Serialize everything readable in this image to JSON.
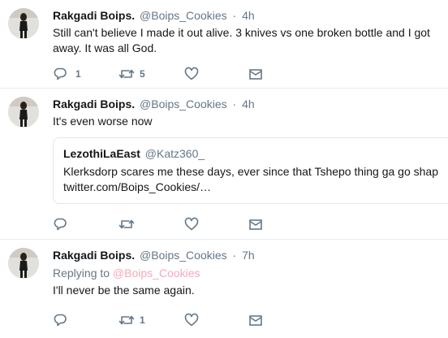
{
  "tweets": [
    {
      "fullname": "Rakgadi Boips.",
      "username": "@Boips_Cookies",
      "separator": "·",
      "time": "4h",
      "text": "Still can't believe I made it out alive. 3 knives vs one broken bottle and I got away. It was all God.",
      "reply_count": "1",
      "retweet_count": "5",
      "like_count": ""
    },
    {
      "fullname": "Rakgadi Boips.",
      "username": "@Boips_Cookies",
      "separator": "·",
      "time": "4h",
      "text": "It's even worse now",
      "quote": {
        "fullname": "LezothiLaEast",
        "username": "@Katz360_",
        "text_line1": "Klerksdorp scares me these days, ever since that Tshepo thing ga go shap",
        "text_line2": "twitter.com/Boips_Cookies/…"
      },
      "reply_count": "",
      "retweet_count": "",
      "like_count": ""
    },
    {
      "fullname": "Rakgadi Boips.",
      "username": "@Boips_Cookies",
      "separator": "·",
      "time": "7h",
      "replying_prefix": "Replying to",
      "replying_to": "@Boips_Cookies",
      "text": "I'll never be the same again.",
      "reply_count": "",
      "retweet_count": "1",
      "like_count": ""
    }
  ],
  "icons": {
    "reply": "reply-icon",
    "retweet": "retweet-icon",
    "like": "heart-icon",
    "message": "envelope-icon"
  },
  "colors": {
    "secondary_text": "#657786",
    "primary_text": "#14171a",
    "mention_link": "#f5a9bb",
    "divider": "#e6ecf0"
  }
}
